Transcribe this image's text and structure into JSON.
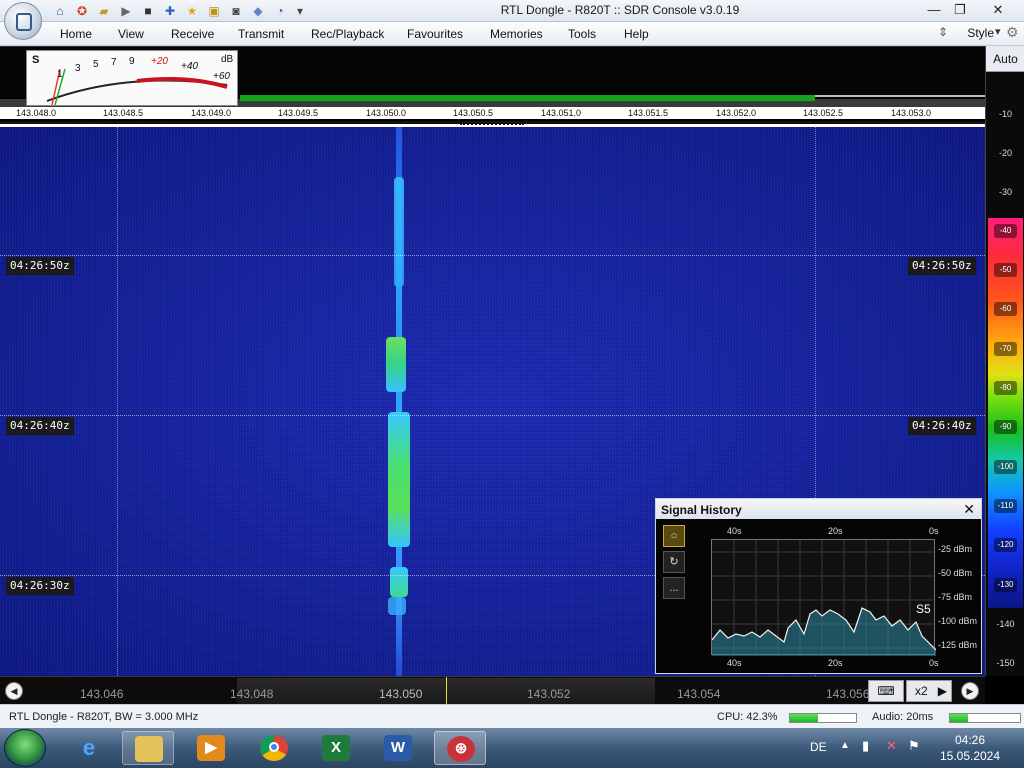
{
  "window": {
    "title": "RTL Dongle - R820T :: SDR Console v3.0.19",
    "minimize": "—",
    "maximize": "❐",
    "close": "✕"
  },
  "menu": {
    "items": [
      "Home",
      "View",
      "Receive",
      "Transmit",
      "Rec/Playback",
      "Favourites",
      "Memories",
      "Tools",
      "Help"
    ],
    "style_label": "Style"
  },
  "smeter": {
    "s_label": "S",
    "db_label": "dB",
    "scale": [
      "1",
      "3",
      "5",
      "7",
      "9",
      "+20",
      "+40",
      "+60"
    ]
  },
  "freq_ruler": {
    "ticks": [
      "143.048.0",
      "143.048.5",
      "143.049.0",
      "143.049.5",
      "143.050.0",
      "143.050.5",
      "143.051.0",
      "143.051.5",
      "143.052.0",
      "143.052.5",
      "143.053.0"
    ]
  },
  "waterfall": {
    "time_labels": [
      "04:26:50z",
      "04:26:40z",
      "04:26:30z"
    ],
    "colors": {
      "background": "#1624a6",
      "signal": "#34b4ff",
      "signal_peak": "#2fe06a"
    }
  },
  "db_scale": {
    "auto_label": "Auto",
    "labels": [
      "-10",
      "-20",
      "-30",
      "-40",
      "-50",
      "-60",
      "-70",
      "-80",
      "-90",
      "-100",
      "-110",
      "-120",
      "-130",
      "-140",
      "-150"
    ]
  },
  "tuner": {
    "freqs": [
      "143.046",
      "143.048",
      "143.050",
      "143.052",
      "143.054",
      "143.056"
    ],
    "zoom_label": "x2",
    "keyboard_icon": "keyboard-icon"
  },
  "status": {
    "device": "RTL Dongle - R820T, BW = 3.000 MHz",
    "cpu": "CPU: 42.3%",
    "cpu_value": 0.423,
    "audio": "Audio: 20ms",
    "audio_level": 0.25
  },
  "signal_history": {
    "title": "Signal History",
    "close": "✕",
    "top_x": [
      "40s",
      "20s",
      "0s"
    ],
    "bottom_x": [
      "40s",
      "20s",
      "0s"
    ],
    "y_labels": [
      "-25 dBm",
      "-50 dBm",
      "-75 dBm",
      "-100 dBm",
      "-125 dBm"
    ],
    "s_reading": "S5",
    "buttons": [
      "○",
      "↻",
      "..."
    ]
  },
  "taskbar": {
    "lang": "DE",
    "time": "04:26",
    "date": "15.05.2024"
  }
}
